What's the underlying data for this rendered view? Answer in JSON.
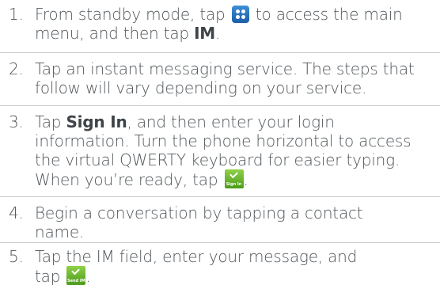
{
  "steps": [
    {
      "number": "1.",
      "line1_pre": "From standby mode, tap",
      "line1_post": "to access the main",
      "line2_pre": "menu, and then tap",
      "line2_bold": "IM",
      "line2_post": "."
    },
    {
      "number": "2.",
      "line1": "Tap an instant messaging service. The steps that",
      "line2": "follow will vary depending on your service."
    },
    {
      "number": "3.",
      "line1_pre": "Tap",
      "line1_bold": "Sign In",
      "line1_post": ", and then enter your login",
      "line2": "information. Turn the phone horizontal to access",
      "line3": "the virtual QWERTY keyboard for easier typing.",
      "line4_pre": "When you’re ready, tap",
      "line4_post": "."
    },
    {
      "number": "4.",
      "line1": "Begin a conversation by tapping a contact",
      "line2": "name."
    },
    {
      "number": "5.",
      "line1": "Tap the IM field, enter your message, and",
      "line2_pre": "tap",
      "line2_post": "."
    }
  ],
  "icons": {
    "menu_icon": "main-menu-grid-icon",
    "sign_in_icon": "sign-in-check-icon",
    "sign_in_caption": "Sign In",
    "send_im_icon": "send-im-check-icon",
    "send_im_caption": "Send IM"
  },
  "colors": {
    "text": "#4f5559",
    "divider": "#c9ccce",
    "menu_icon": "#2a74c2",
    "action_icon": "#6cb52c"
  }
}
